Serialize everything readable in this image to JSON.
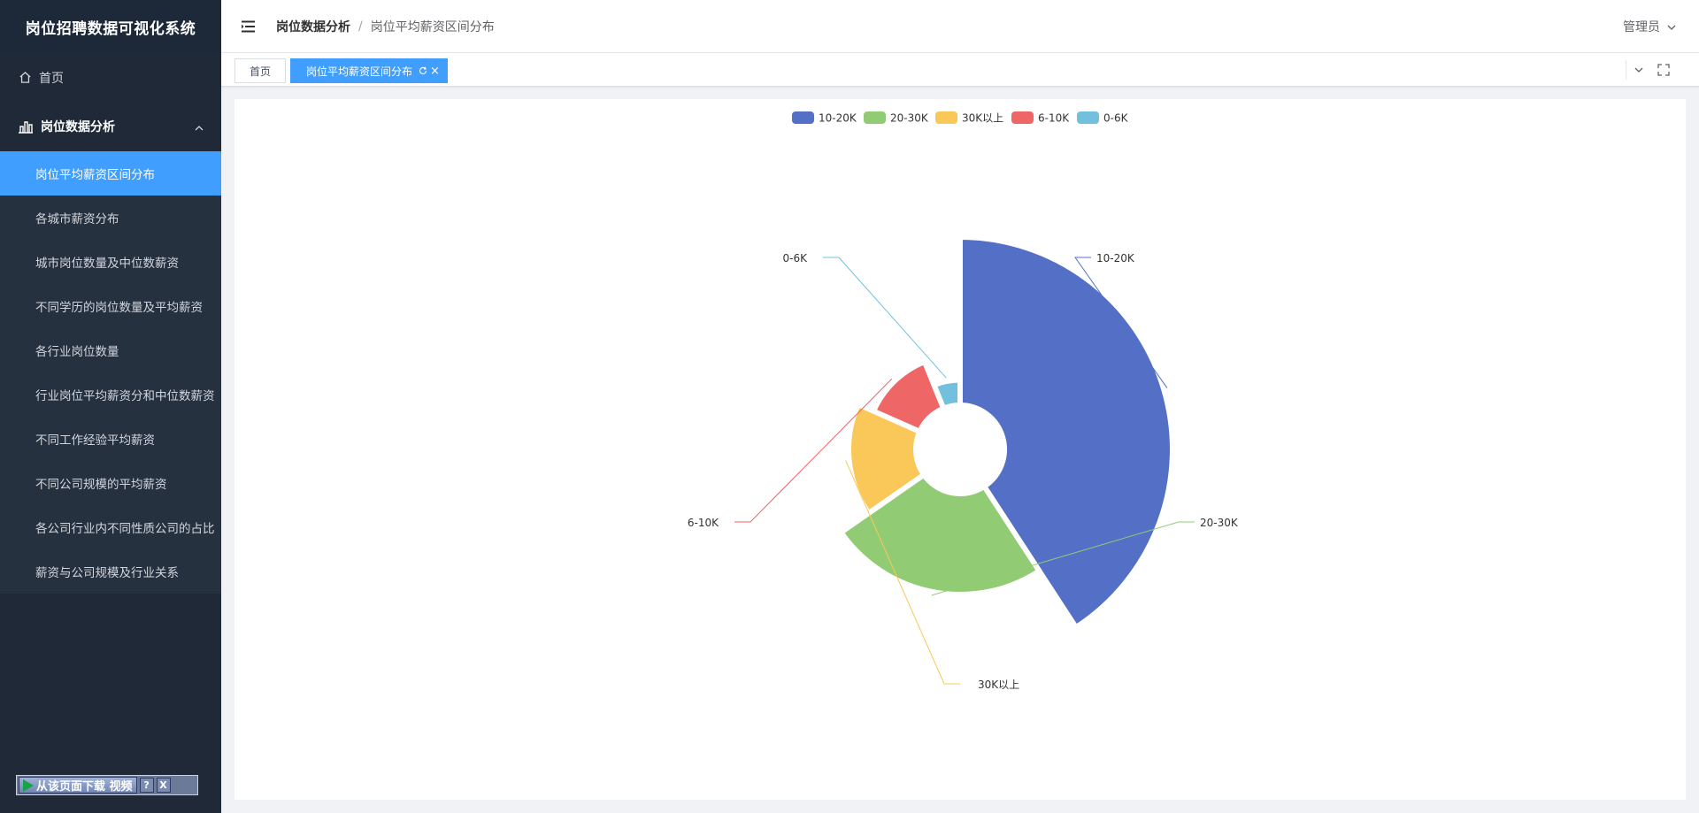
{
  "app": {
    "title": "岗位招聘数据可视化系统"
  },
  "sidebar": {
    "home_label": "首页",
    "group_label": "岗位数据分析",
    "items": [
      {
        "label": "岗位平均薪资区间分布"
      },
      {
        "label": "各城市薪资分布"
      },
      {
        "label": "城市岗位数量及中位数薪资"
      },
      {
        "label": "不同学历的岗位数量及平均薪资"
      },
      {
        "label": "各行业岗位数量"
      },
      {
        "label": "行业岗位平均薪资分和中位数薪资"
      },
      {
        "label": "不同工作经验平均薪资"
      },
      {
        "label": "不同公司规模的平均薪资"
      },
      {
        "label": "各公司行业内不同性质公司的占比"
      },
      {
        "label": "薪资与公司规模及行业关系"
      }
    ],
    "download_label": "从该页面下载 视频",
    "help_label": "?",
    "close_label": "X"
  },
  "header": {
    "breadcrumb": [
      "岗位数据分析",
      "岗位平均薪资区间分布"
    ],
    "separator": "/",
    "user_label": "管理员"
  },
  "tags": {
    "home": "首页",
    "active": "岗位平均薪资区间分布",
    "close_glyph": "×"
  },
  "colors": {
    "accent": "#409eff",
    "sidebar_bg": "#1f2937"
  },
  "chart_data": {
    "type": "pie",
    "variant": "nightingale-rose",
    "legend_position": "top-center",
    "categories": [
      "10-20K",
      "20-30K",
      "30K以上",
      "6-10K",
      "0-6K"
    ],
    "values": [
      200,
      120,
      80,
      60,
      30
    ],
    "colors": [
      "#5470c6",
      "#91cc75",
      "#fac858",
      "#ee6666",
      "#73c0de"
    ],
    "labels": [
      "10-20K",
      "20-30K",
      "30K以上",
      "6-10K",
      "0-6K"
    ]
  }
}
